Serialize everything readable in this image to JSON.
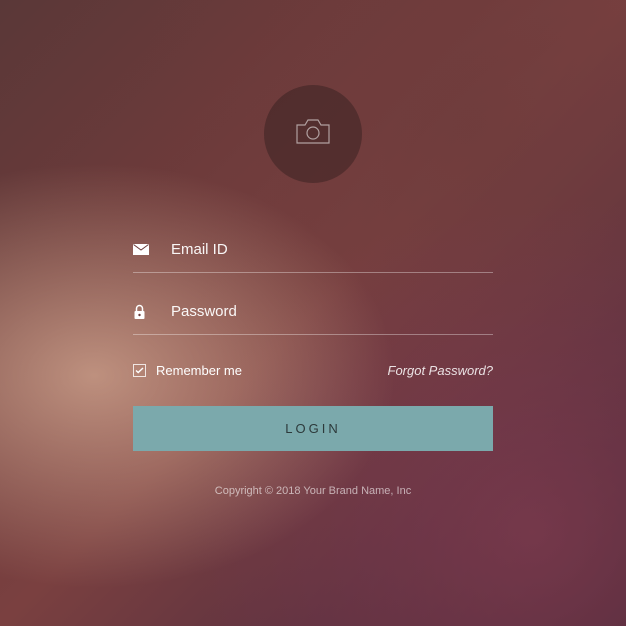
{
  "avatar": {
    "icon": "camera-icon"
  },
  "fields": {
    "email": {
      "placeholder": "Email ID",
      "value": ""
    },
    "password": {
      "placeholder": "Password",
      "value": ""
    }
  },
  "remember": {
    "label": "Remember me",
    "checked": true
  },
  "forgot": {
    "label": "Forgot Password?"
  },
  "button": {
    "label": "LOGIN"
  },
  "footer": {
    "copyright": "Copyright © 2018 Your Brand Name, Inc"
  },
  "colors": {
    "accent": "#7ba9ac"
  }
}
